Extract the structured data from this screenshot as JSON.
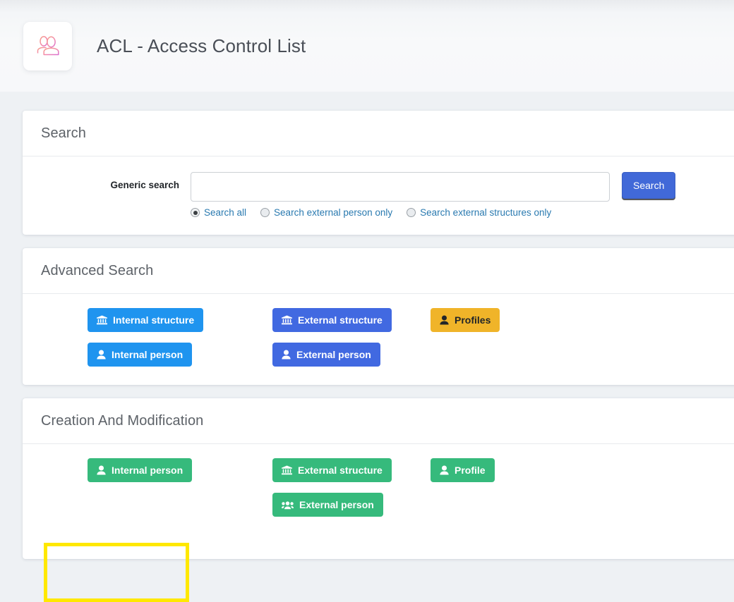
{
  "header": {
    "title": "ACL - Access Control List",
    "icon": "users-outline-icon"
  },
  "search_card": {
    "heading": "Search",
    "generic_search_label": "Generic search",
    "input_value": "",
    "input_placeholder": "",
    "search_button_label": "Search",
    "radios": [
      {
        "label": "Search all",
        "checked": true
      },
      {
        "label": "Search external person only",
        "checked": false
      },
      {
        "label": "Search external structures only",
        "checked": false
      }
    ]
  },
  "advanced_search_card": {
    "heading": "Advanced Search",
    "buttons": [
      {
        "label": "Internal structure",
        "icon": "bank-icon",
        "color": "#1f94ef",
        "style": "blue-light"
      },
      {
        "label": "External structure",
        "icon": "bank-icon",
        "color": "#4169e1",
        "style": "blue-dark"
      },
      {
        "label": "Profiles",
        "icon": "person-icon",
        "color": "#f0b429",
        "style": "amber"
      },
      {
        "label": "Internal person",
        "icon": "person-icon",
        "color": "#1f94ef",
        "style": "blue-light"
      },
      {
        "label": "External person",
        "icon": "person-icon",
        "color": "#4169e1",
        "style": "blue-dark"
      }
    ]
  },
  "creation_card": {
    "heading": "Creation And Modification",
    "buttons": [
      {
        "label": "Internal person",
        "icon": "person-icon",
        "color": "#36ba7c",
        "style": "green",
        "highlighted": true
      },
      {
        "label": "External structure",
        "icon": "bank-icon",
        "color": "#36ba7c",
        "style": "green",
        "highlighted": false
      },
      {
        "label": "Profile",
        "icon": "person-icon",
        "color": "#36ba7c",
        "style": "green",
        "highlighted": false
      },
      {
        "label": "External person",
        "icon": "users-icon",
        "color": "#36ba7c",
        "style": "green",
        "highlighted": false
      }
    ]
  },
  "colors": {
    "page_background": "#eef1f4",
    "header_background": "#f7f8fa",
    "card_background": "#ffffff",
    "heading_text": "#5d6268",
    "link_blue": "#2a7ab0",
    "highlight": "#ffe800"
  }
}
